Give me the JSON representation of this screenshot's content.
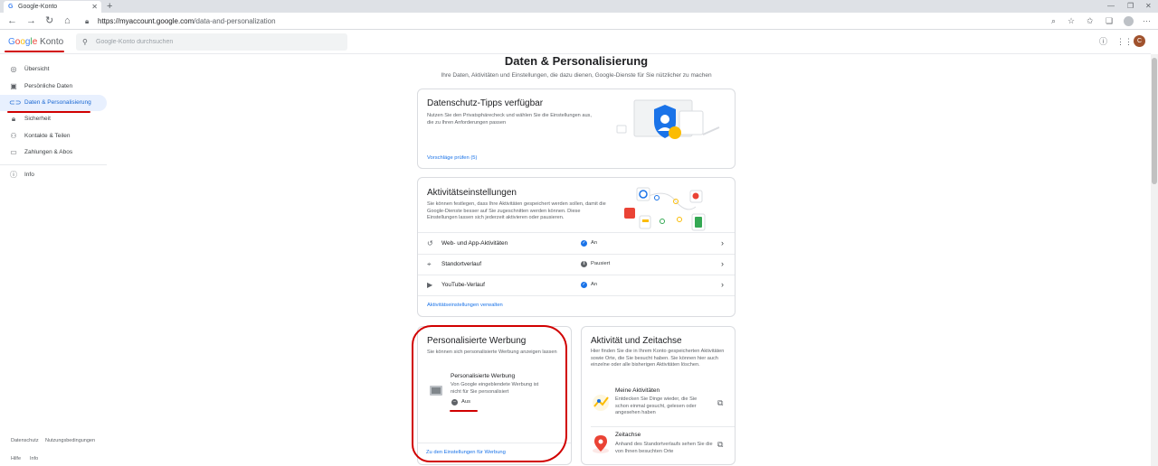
{
  "browser": {
    "tab_title": "Google-Konto",
    "tab_favicon": "G",
    "url_host": "https://myaccount.google.com",
    "url_path": "/data-and-personalization"
  },
  "header": {
    "logo_google": [
      "G",
      "o",
      "o",
      "g",
      "l",
      "e"
    ],
    "logo_konto": "Konto",
    "search_placeholder": "Google-Konto durchsuchen",
    "avatar_letter": "C"
  },
  "sidebar": {
    "items": [
      {
        "label": "Übersicht",
        "icon": "home-icon"
      },
      {
        "label": "Persönliche Daten",
        "icon": "id-card-icon"
      },
      {
        "label": "Daten & Personalisierung",
        "icon": "toggle-icon"
      },
      {
        "label": "Sicherheit",
        "icon": "lock-icon"
      },
      {
        "label": "Kontakte & Teilen",
        "icon": "people-icon"
      },
      {
        "label": "Zahlungen & Abos",
        "icon": "credit-card-icon"
      }
    ],
    "info": "Info",
    "footer": {
      "datenschutz": "Datenschutz",
      "nutzungsbedingungen": "Nutzungsbedingungen",
      "hilfe": "Hilfe",
      "info": "Info"
    }
  },
  "main": {
    "title": "Daten & Personalisierung",
    "subtitle": "Ihre Daten, Aktivitäten und Einstellungen, die dazu dienen, Google-Dienste für Sie nützlicher zu machen",
    "privacy_card": {
      "title": "Datenschutz-Tipps verfügbar",
      "desc": "Nutzen Sie den Privatsphärecheck und wählen Sie die Einstellungen aus, die zu Ihren Anforderungen passen",
      "link": "Vorschläge prüfen (5)"
    },
    "activity_card": {
      "title": "Aktivitätseinstellungen",
      "desc": "Sie können festlegen, dass Ihre Aktivitäten gespeichert werden sollen, damit die Google-Dienste besser auf Sie zugeschnitten werden können. Diese Einstellungen lassen sich jederzeit aktivieren oder pausieren.",
      "rows": [
        {
          "label": "Web- und App-Aktivitäten",
          "status": "An",
          "state": "on"
        },
        {
          "label": "Standortverlauf",
          "status": "Pausiert",
          "state": "off"
        },
        {
          "label": "YouTube-Verlauf",
          "status": "An",
          "state": "on"
        }
      ],
      "link": "Aktivitätseinstellungen verwalten"
    },
    "ads_card": {
      "title": "Personalisierte Werbung",
      "desc": "Sie können sich personalisierte Werbung anzeigen lassen",
      "sub_title": "Personalisierte Werbung",
      "sub_desc": "Von Google eingeblendete Werbung ist nicht für Sie personalisiert",
      "status": "Aus",
      "link": "Zu den Einstellungen für Werbung"
    },
    "timeline_card": {
      "title": "Aktivität und Zeitachse",
      "desc": "Hier finden Sie die in Ihrem Konto gespeicherten Aktivitäten sowie Orte, die Sie besucht haben. Sie können hier auch einzelne oder alle bisherigen Aktivitäten löschen.",
      "items": [
        {
          "title": "Meine Aktivitäten",
          "desc": "Entdecken Sie Dinge wieder, die Sie schon einmal gesucht, gelesen oder angesehen haben"
        },
        {
          "title": "Zeitachse",
          "desc": "Anhand des Standortverlaufs sehen Sie die von Ihnen besuchten Orte"
        }
      ]
    }
  },
  "colors": {
    "accent": "#1a73e8",
    "annotation": "#d10000",
    "active_bg": "#e8f0fe"
  }
}
